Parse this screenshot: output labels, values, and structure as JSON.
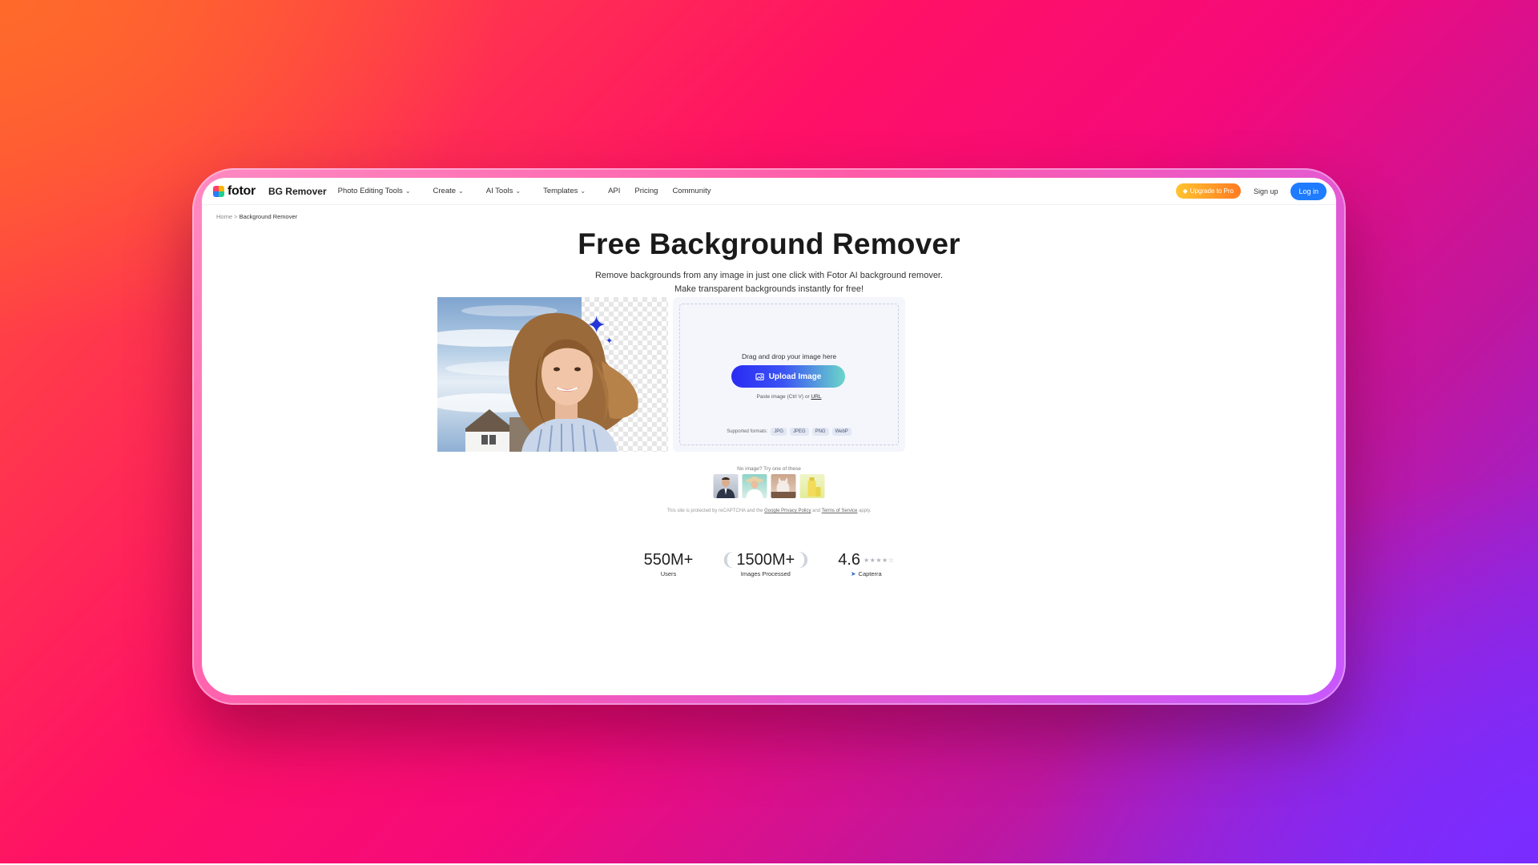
{
  "nav": {
    "logo_text": "fotor",
    "product": "BG Remover",
    "items": [
      {
        "label": "Photo Editing Tools",
        "dropdown": true
      },
      {
        "label": "Create",
        "dropdown": true
      },
      {
        "label": "AI Tools",
        "dropdown": true
      },
      {
        "label": "Templates",
        "dropdown": true
      },
      {
        "label": "API",
        "dropdown": false
      },
      {
        "label": "Pricing",
        "dropdown": false
      },
      {
        "label": "Community",
        "dropdown": false
      }
    ],
    "upgrade_label": "Upgrade to Pro",
    "signup_label": "Sign up",
    "login_label": "Log in"
  },
  "breadcrumb": {
    "home": "Home",
    "separator": ">",
    "current": "Background Remover"
  },
  "hero": {
    "title": "Free Background Remover",
    "subtitle": "Remove backgrounds from any image in just one click with Fotor AI background remover. Make transparent backgrounds instantly for free!"
  },
  "upload": {
    "drag_text": "Drag and drop your image here",
    "button_label": "Upload Image",
    "paste_text": "Paste image (Ctrl V) or",
    "url_link": "URL",
    "formats_label": "Supported formats:",
    "formats": [
      "JPG",
      "JPEG",
      "PNG",
      "WebP"
    ]
  },
  "samples": {
    "prompt": "No image? Try one of these"
  },
  "recaptcha": {
    "prefix": "This site is protected by reCAPTCHA and the",
    "privacy": "Google Privacy Policy",
    "and": "and",
    "terms": "Terms of Service",
    "suffix": "apply."
  },
  "stats": [
    {
      "value": "550M+",
      "label": "Users"
    },
    {
      "value": "1500M+",
      "label": "Images Processed"
    },
    {
      "value": "4.6",
      "label": "Capterra",
      "rating": 4.6
    }
  ],
  "colors": {
    "accent": "#1f7bff",
    "upload_start": "#2a2bf2",
    "upload_end": "#6ad6c9",
    "upgrade_start": "#ffc42e",
    "upgrade_end": "#ff7b22"
  }
}
